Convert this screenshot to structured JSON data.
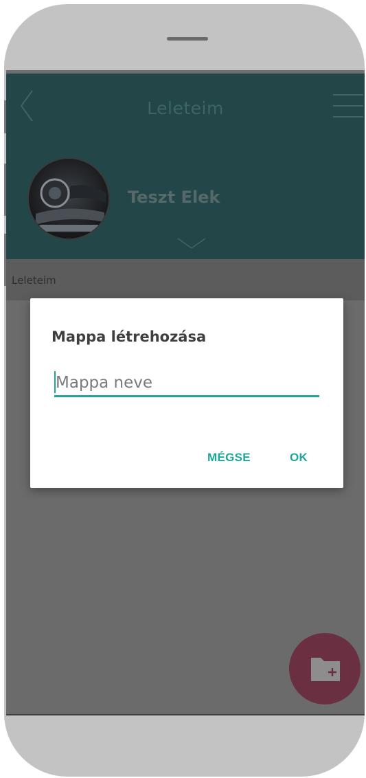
{
  "header": {
    "title": "Leleteim",
    "user_name": "Teszt Elek",
    "back_icon": "chevron-left-icon",
    "menu_icon": "hamburger-menu-icon",
    "expand_icon": "chevron-down-icon"
  },
  "breadcrumb": {
    "label": "Leleteim"
  },
  "dialog": {
    "title": "Mappa létrehozása",
    "input_value": "",
    "input_placeholder": "Mappa neve",
    "cancel_label": "MÉGSE",
    "ok_label": "OK"
  },
  "fab": {
    "icon": "folder-add-icon"
  },
  "colors": {
    "header_bg": "#234749",
    "accent": "#1fa69a",
    "fab": "#6a3042",
    "overlay": "#6b6b6b"
  }
}
